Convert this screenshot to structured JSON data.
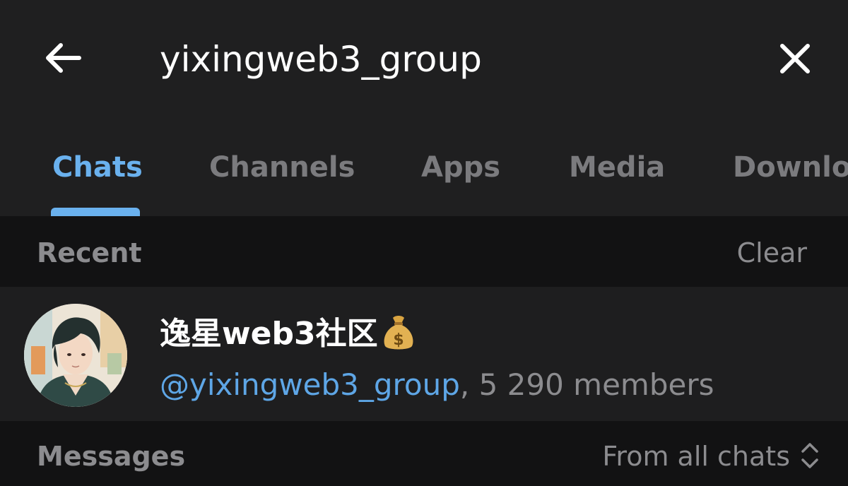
{
  "search": {
    "query": "yixingweb3_group"
  },
  "tabs": [
    {
      "label": "Chats",
      "active": true
    },
    {
      "label": "Channels",
      "active": false
    },
    {
      "label": "Apps",
      "active": false
    },
    {
      "label": "Media",
      "active": false
    },
    {
      "label": "Downloa",
      "active": false
    }
  ],
  "recent": {
    "title": "Recent",
    "action": "Clear"
  },
  "chat": {
    "name": "逸星web3社区",
    "handle": "@yixingweb3_group",
    "members": ", 5 290 members",
    "avatar_icon": "anime-portrait-avatar"
  },
  "messages": {
    "title": "Messages",
    "filter": "From all chats"
  },
  "colors": {
    "accent": "#6ab1ee",
    "link": "#5ea6e6",
    "background": "#1e1e1f",
    "section_background": "#121213",
    "muted_text": "#8c8c8f"
  }
}
